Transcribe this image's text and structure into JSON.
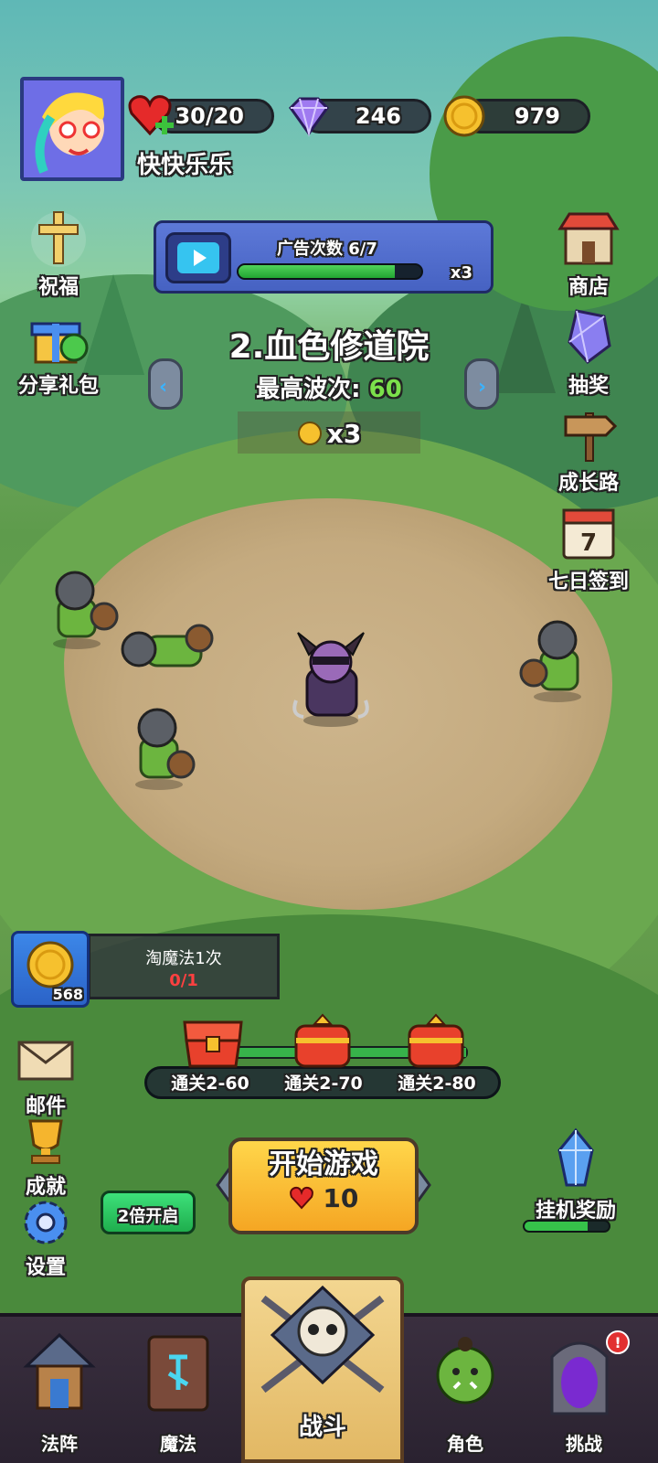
{
  "player": {
    "name": "快快乐乐"
  },
  "resources": {
    "hearts": "30/20",
    "gems": "246",
    "coins": "979"
  },
  "left_menu": {
    "blessing": "祝福",
    "share_gift": "分享礼包"
  },
  "right_menu": {
    "shop": "商店",
    "lottery": "抽奖",
    "growth_path": "成长路",
    "seven_day_signin": "七日签到",
    "calendar_day": "7"
  },
  "ad_panel": {
    "title": "广告次数 6/7",
    "progress": 0.857,
    "multiplier": "x3"
  },
  "stage": {
    "title": "2.血色修道院",
    "wave_label": "最高波次:",
    "wave_value": "60",
    "coin_multiplier": "x3"
  },
  "magic": {
    "coin_count": "568",
    "title": "淘魔法1次",
    "progress": "0/1"
  },
  "chests": [
    {
      "label": "通关2-60"
    },
    {
      "label": "通关2-70"
    },
    {
      "label": "通关2-80"
    }
  ],
  "bottom_left": {
    "mail": "邮件",
    "achievement": "成就",
    "settings": "设置"
  },
  "start_button": {
    "label": "开始游戏",
    "cost": "10"
  },
  "double_button": {
    "label": "2倍开启"
  },
  "idle_reward": {
    "label": "挂机奖励",
    "progress": 0.75
  },
  "nav": {
    "formation": "法阵",
    "magic": "魔法",
    "battle": "战斗",
    "character": "角色",
    "challenge": "挑战"
  },
  "colors": {
    "wave_green": "#7be04b",
    "progress_green": "#37b24a",
    "badge_red": "#e23030"
  }
}
